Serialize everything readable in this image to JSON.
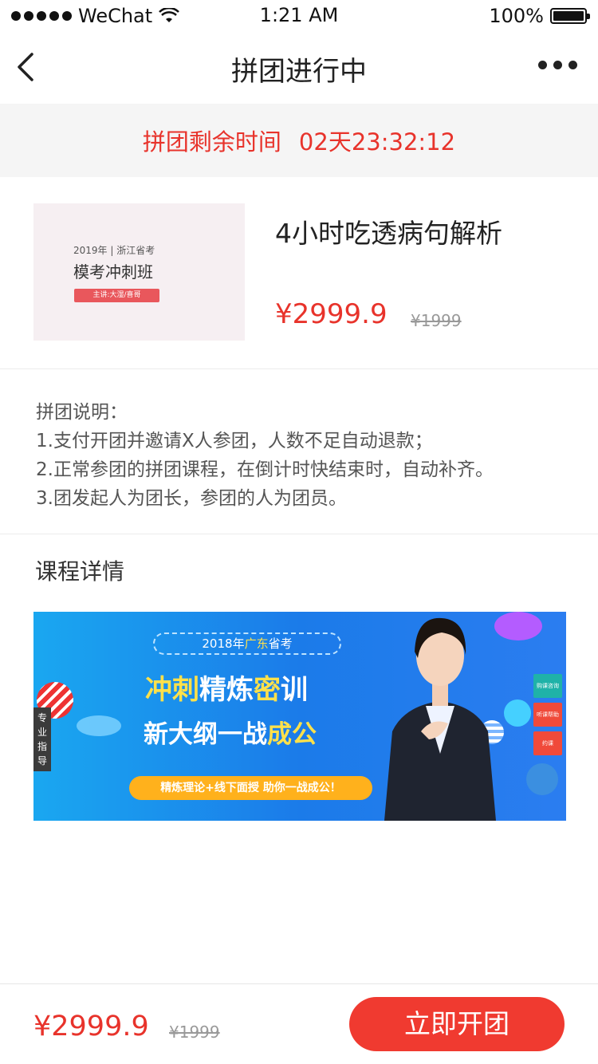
{
  "status_bar": {
    "carrier": "WeChat",
    "time": "1:21 AM",
    "battery": "100%"
  },
  "nav": {
    "title": "拼团进行中"
  },
  "countdown": {
    "label": "拼团剩余时间",
    "time": "02天23:32:12"
  },
  "product": {
    "thumb": {
      "line1": "2019年 | 浙江省考",
      "line2": "模考冲刺班",
      "tag": "主讲:大湿/喜哥"
    },
    "title": "4小时吃透病句解析",
    "price": "¥2999.9",
    "original_price": "¥1999"
  },
  "rules": {
    "heading": "拼团说明：",
    "items": [
      "1.支付开团并邀请X人参团，人数不足自动退款；",
      "2.正常参团的拼团课程，在倒计时快结束时，自动补齐。",
      "3.团发起人为团长，参团的人为团员。"
    ]
  },
  "details": {
    "title": "课程详情",
    "banner": {
      "pill_year": "2018年",
      "pill_region": "广东",
      "pill_suffix": "省考",
      "line1_a": "冲刺",
      "line1_b": "精炼",
      "line1_c": "密",
      "line1_d": "训",
      "line2_a": "新大纲一战",
      "line2_b": "成公",
      "bar": "精炼理论+线下面授   助你一战成公！",
      "side": "专业指导",
      "right_buttons": [
        "购课咨询",
        "听课帮助",
        "约课"
      ]
    }
  },
  "bottom_bar": {
    "price": "¥2999.9",
    "original_price": "¥1999",
    "cta": "立即开团"
  },
  "colors": {
    "accent": "#e8332b",
    "button": "#f03a30",
    "banner_blue": "#1b7be9"
  }
}
